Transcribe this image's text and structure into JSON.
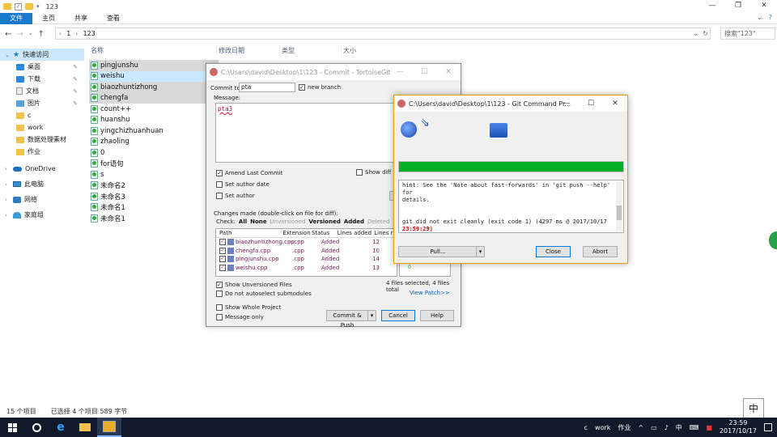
{
  "explorer": {
    "title_path": "123",
    "window_controls": [
      "—",
      "❐",
      "✕"
    ],
    "ribbon_tabs": [
      "文件",
      "主页",
      "共享",
      "查看"
    ],
    "address_crumbs": [
      "1",
      "123"
    ],
    "search_placeholder": "搜索\"123\"",
    "columns": [
      "名称",
      "修改日期",
      "类型",
      "大小"
    ],
    "nav": [
      {
        "label": "快速访问",
        "icon": "star-icon",
        "selected": true,
        "child": false
      },
      {
        "label": "桌面",
        "icon": "desktop-folder-icon",
        "child": true,
        "pinned": true
      },
      {
        "label": "下载",
        "icon": "download-icon",
        "child": true,
        "pinned": true
      },
      {
        "label": "文档",
        "icon": "document-icon",
        "child": true,
        "pinned": true
      },
      {
        "label": "图片",
        "icon": "pictures-icon",
        "child": true,
        "pinned": true
      },
      {
        "label": "c",
        "icon": "folder-icon",
        "child": true
      },
      {
        "label": "work",
        "icon": "folder-icon",
        "child": true
      },
      {
        "label": "数据处理素材",
        "icon": "folder-icon",
        "child": true
      },
      {
        "label": "作业",
        "icon": "folder-icon",
        "child": true
      },
      {
        "label": "OneDrive",
        "icon": "onedrive-icon",
        "child": false
      },
      {
        "label": "此电脑",
        "icon": "computer-icon",
        "child": false
      },
      {
        "label": "网络",
        "icon": "network-icon",
        "child": false
      },
      {
        "label": "家庭组",
        "icon": "homegroup-icon",
        "child": false
      }
    ],
    "files": [
      {
        "name": "pingjunshu",
        "state": "sel2"
      },
      {
        "name": "weishu",
        "state": "sel"
      },
      {
        "name": "biaozhuntizhong",
        "state": "sel2"
      },
      {
        "name": "chengfa",
        "state": "sel2"
      },
      {
        "name": "count++",
        "state": ""
      },
      {
        "name": "huanshu",
        "state": ""
      },
      {
        "name": "yingchizhuanhuan",
        "state": ""
      },
      {
        "name": "zhaoling",
        "state": ""
      },
      {
        "name": "0",
        "state": ""
      },
      {
        "name": "for语句",
        "state": ""
      },
      {
        "name": "s",
        "state": ""
      },
      {
        "name": "未命名2",
        "state": ""
      },
      {
        "name": "未命名3",
        "state": ""
      },
      {
        "name": "未命名1",
        "state": ""
      },
      {
        "name": "未命名1",
        "state": ""
      }
    ],
    "status_count": "15 个项目",
    "status_selected": "已选择 4 个项目  589 字节",
    "ime": "中"
  },
  "commit": {
    "title": "C:\\Users\\david\\Desktop\\1\\123 - Commit - TortoiseGit",
    "commit_to_label": "Commit to:",
    "commit_to_value": "pta",
    "new_branch_label": "new branch",
    "message_label": "Message:",
    "message_value": "pta3",
    "amend_label": "Amend Last Commit",
    "show_diff_label": "Show diff to",
    "set_author_date_label": "Set author date",
    "set_author_label": "Set author",
    "changes_label": "Changes made (double-click on file for diff):",
    "check_label": "Check:",
    "filters": [
      {
        "label": "All",
        "dim": false
      },
      {
        "label": "None",
        "dim": false
      },
      {
        "label": "Unversioned",
        "dim": true
      },
      {
        "label": "Versioned",
        "dim": false
      },
      {
        "label": "Added",
        "dim": false
      },
      {
        "label": "Deleted",
        "dim": true
      },
      {
        "label": "Modifie",
        "dim": true
      }
    ],
    "grid_headers": [
      "Path",
      "Extension",
      "Status",
      "Lines added",
      "Lines r"
    ],
    "rows": [
      {
        "path": "biaozhuntizhong.cpp",
        "ext": ".cpp",
        "status": "Added",
        "lines": "12"
      },
      {
        "path": "chengfa.cpp",
        "ext": ".cpp",
        "status": "Added",
        "lines": "10"
      },
      {
        "path": "pingjunshu.cpp",
        "ext": ".cpp",
        "status": "Added",
        "lines": "14"
      },
      {
        "path": "weishu.cpp",
        "ext": ".cpp",
        "status": "Added",
        "lines": "13"
      }
    ],
    "selected_summary": "4 files selected, 4 files total",
    "view_patch": "View Patch>>",
    "show_unversioned": "Show Unversioned Files",
    "no_autoselect": "Do not autoselect submodules",
    "show_whole_project": "Show Whole Project",
    "message_only": "Message only",
    "commit_push": "Commit & Push",
    "cancel": "Cancel",
    "help": "Help",
    "ctrls": [
      "—",
      "☐",
      "✕"
    ]
  },
  "progress": {
    "title": "C:\\Users\\david\\Desktop\\1\\123 - Git Command Pr...",
    "ctrls": [
      "—",
      "☐",
      "✕"
    ],
    "progress_fraction": 1.0,
    "log_line1": "hint: See the 'Note about fast-forwards' in 'git push --help' for",
    "log_line2": "details.",
    "log_line3": "git did not exit cleanly (exit code 1) (4297 ms @ 2017/10/17",
    "log_line4": "23:59:29)",
    "pull_label": "Pull...",
    "close_label": "Close",
    "abort_label": "Abort",
    "bar_color": "#06b025"
  },
  "taskbar": {
    "tray_items": [
      "c",
      "work",
      "作业"
    ],
    "tray_chevron": "^",
    "ime": "中",
    "time": "23:59",
    "date": "2017/10/17"
  }
}
